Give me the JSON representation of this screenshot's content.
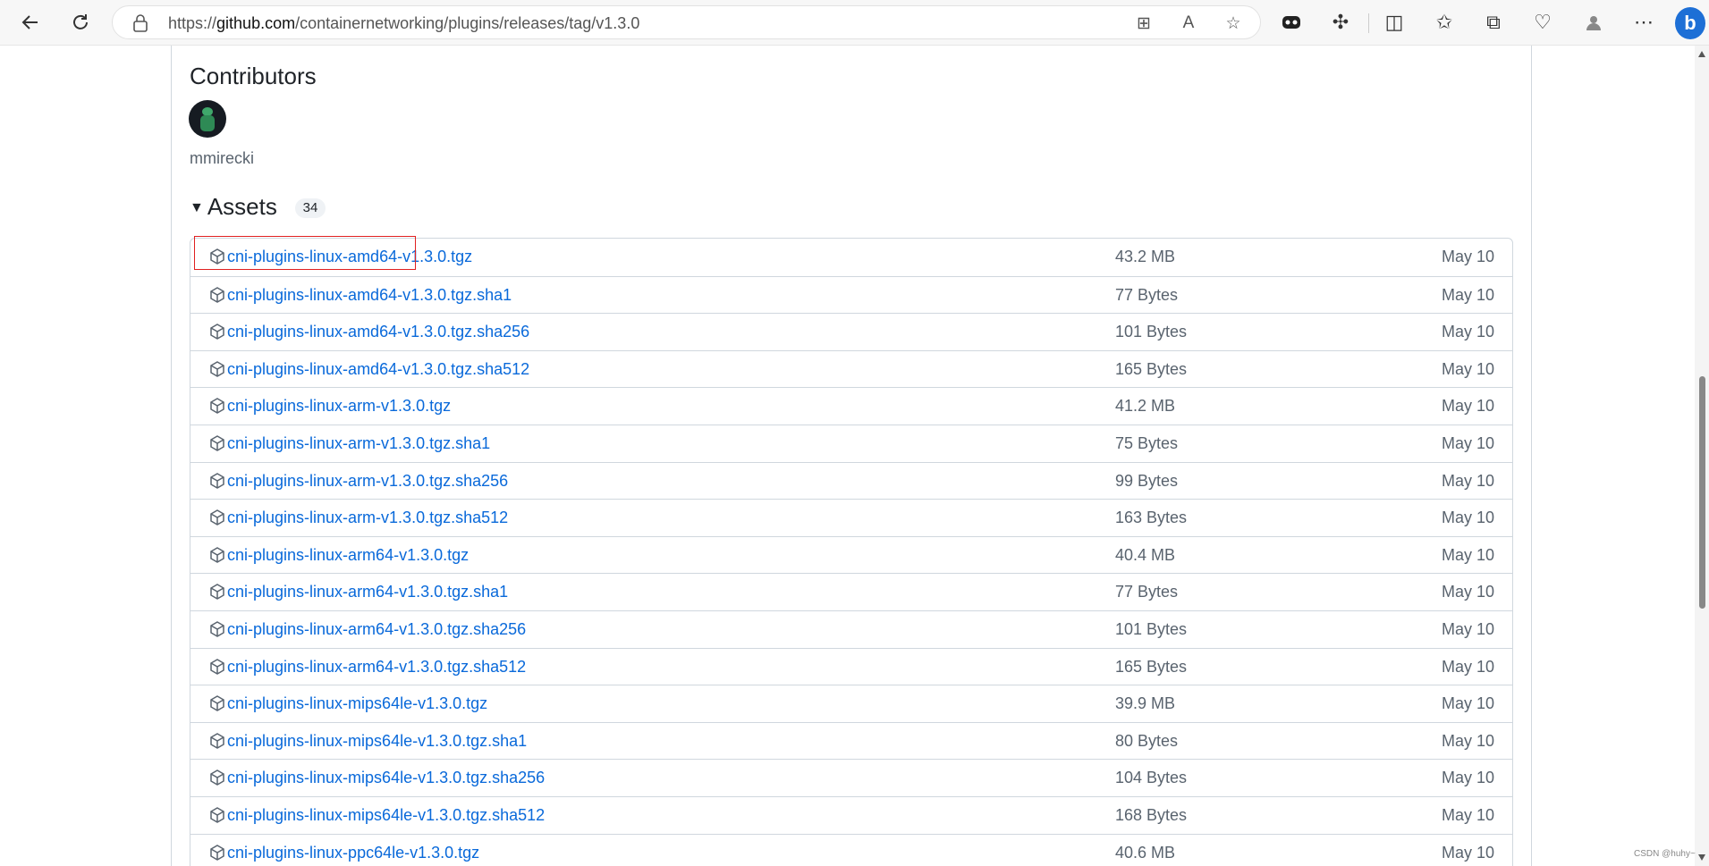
{
  "browser": {
    "url_prefix": "https://",
    "url_host": "github.com",
    "url_path": "/containernetworking/plugins/releases/tag/v1.3.0",
    "bing_label": "b"
  },
  "contributors": {
    "title": "Contributors",
    "users": [
      "mmirecki"
    ]
  },
  "assets": {
    "title": "Assets",
    "count": "34",
    "items": [
      {
        "name": "cni-plugins-linux-amd64-v1.3.0.tgz",
        "size": "43.2 MB",
        "date": "May 10"
      },
      {
        "name": "cni-plugins-linux-amd64-v1.3.0.tgz.sha1",
        "size": "77 Bytes",
        "date": "May 10"
      },
      {
        "name": "cni-plugins-linux-amd64-v1.3.0.tgz.sha256",
        "size": "101 Bytes",
        "date": "May 10"
      },
      {
        "name": "cni-plugins-linux-amd64-v1.3.0.tgz.sha512",
        "size": "165 Bytes",
        "date": "May 10"
      },
      {
        "name": "cni-plugins-linux-arm-v1.3.0.tgz",
        "size": "41.2 MB",
        "date": "May 10"
      },
      {
        "name": "cni-plugins-linux-arm-v1.3.0.tgz.sha1",
        "size": "75 Bytes",
        "date": "May 10"
      },
      {
        "name": "cni-plugins-linux-arm-v1.3.0.tgz.sha256",
        "size": "99 Bytes",
        "date": "May 10"
      },
      {
        "name": "cni-plugins-linux-arm-v1.3.0.tgz.sha512",
        "size": "163 Bytes",
        "date": "May 10"
      },
      {
        "name": "cni-plugins-linux-arm64-v1.3.0.tgz",
        "size": "40.4 MB",
        "date": "May 10"
      },
      {
        "name": "cni-plugins-linux-arm64-v1.3.0.tgz.sha1",
        "size": "77 Bytes",
        "date": "May 10"
      },
      {
        "name": "cni-plugins-linux-arm64-v1.3.0.tgz.sha256",
        "size": "101 Bytes",
        "date": "May 10"
      },
      {
        "name": "cni-plugins-linux-arm64-v1.3.0.tgz.sha512",
        "size": "165 Bytes",
        "date": "May 10"
      },
      {
        "name": "cni-plugins-linux-mips64le-v1.3.0.tgz",
        "size": "39.9 MB",
        "date": "May 10"
      },
      {
        "name": "cni-plugins-linux-mips64le-v1.3.0.tgz.sha1",
        "size": "80 Bytes",
        "date": "May 10"
      },
      {
        "name": "cni-plugins-linux-mips64le-v1.3.0.tgz.sha256",
        "size": "104 Bytes",
        "date": "May 10"
      },
      {
        "name": "cni-plugins-linux-mips64le-v1.3.0.tgz.sha512",
        "size": "168 Bytes",
        "date": "May 10"
      },
      {
        "name": "cni-plugins-linux-ppc64le-v1.3.0.tgz",
        "size": "40.6 MB",
        "date": "May 10"
      }
    ]
  },
  "watermark": "CSDN @huhy~",
  "colors": {
    "link": "#0969da",
    "highlight": "#e02020"
  }
}
